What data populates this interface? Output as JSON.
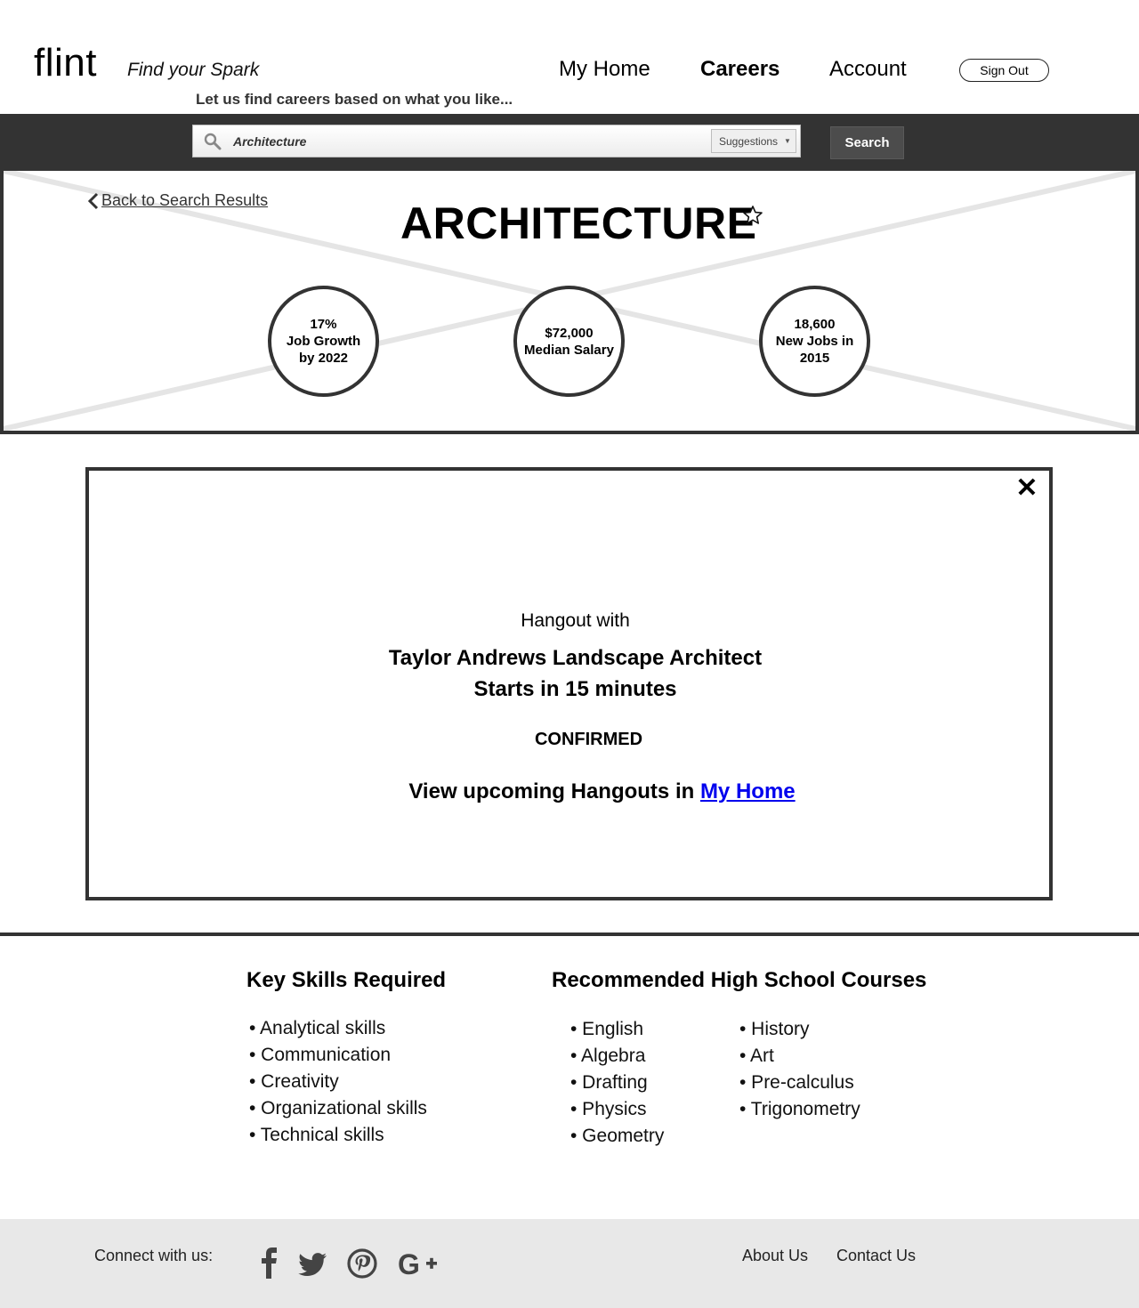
{
  "header": {
    "logo": "flint",
    "tagline": "Find your Spark",
    "subtagline": "Let us find careers based on what you like...",
    "nav": {
      "home": "My Home",
      "careers": "Careers",
      "account": "Account"
    },
    "signout": "Sign Out"
  },
  "search": {
    "value": "Architecture",
    "suggestions_label": "Suggestions",
    "button": "Search"
  },
  "hero": {
    "back_link": "Back to Search Results",
    "title": "ARCHITECTURE",
    "stats": [
      {
        "line1": "17%",
        "line2": "Job Growth",
        "line3": "by 2022"
      },
      {
        "line1": "$72,000",
        "line2": "Median Salary",
        "line3": ""
      },
      {
        "line1": "18,600",
        "line2": "New Jobs in",
        "line3": "2015"
      }
    ]
  },
  "modal": {
    "close": "✕",
    "with_label": "Hangout with",
    "name": "Taylor Andrews Landscape Architect",
    "time": "Starts in 15 minutes",
    "status": "CONFIRMED",
    "view_prefix": "View upcoming Hangouts in",
    "view_link": "My Home"
  },
  "skills": {
    "title": "Key Skills Required",
    "items": [
      "• Analytical skills",
      "• Communication",
      "• Creativity",
      "• Organizational skills",
      "• Technical skills"
    ]
  },
  "courses": {
    "title": "Recommended High School Courses",
    "col1": [
      "• English",
      "• Algebra",
      "• Drafting",
      "• Physics",
      "• Geometry"
    ],
    "col2": [
      "• History",
      "•  Art",
      "• Pre-calculus",
      "• Trigonometry"
    ]
  },
  "footer": {
    "connect": "Connect with us:",
    "about": "About Us",
    "contact": "Contact Us",
    "social_icons": [
      "facebook-icon",
      "twitter-icon",
      "pinterest-icon",
      "google-plus-icon"
    ]
  }
}
